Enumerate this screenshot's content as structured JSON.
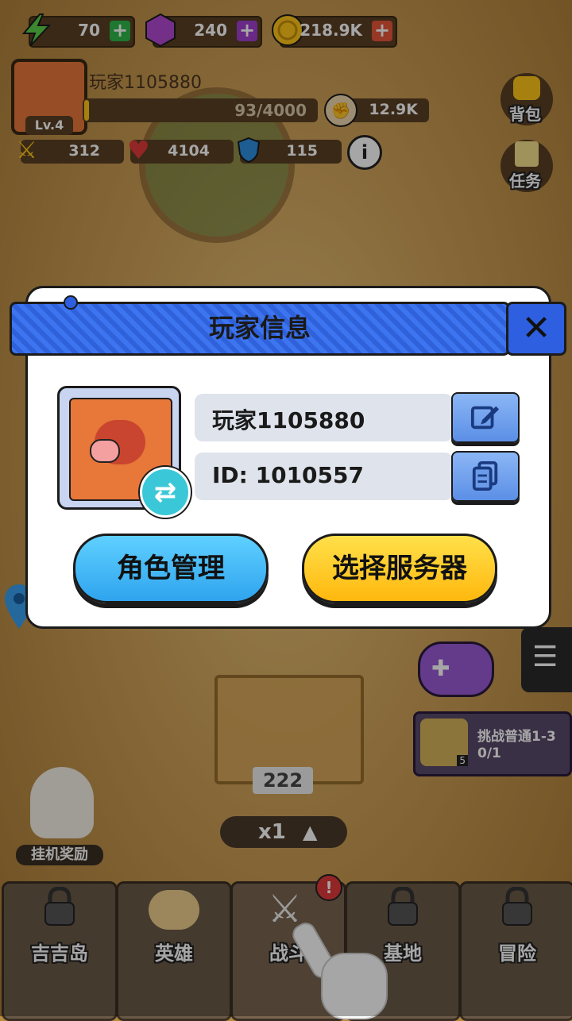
{
  "resources": {
    "energy": "70",
    "gems": "240",
    "coins": "218.9K"
  },
  "player": {
    "name": "玩家1105880",
    "level": "Lv.4",
    "exp": "93/4000",
    "power": "12.9K"
  },
  "stats": {
    "attack": "312",
    "hp": "4104",
    "defense": "115"
  },
  "side_buttons": {
    "bag": "背包",
    "task": "任务"
  },
  "dialog": {
    "title": "玩家信息",
    "name_value": "玩家1105880",
    "id_value": "ID: 1010557",
    "role_button": "角色管理",
    "server_button": "选择服务器"
  },
  "challenge": {
    "title": "挑战普通1-3",
    "progress": "0/1",
    "badge": "5"
  },
  "box_count": "222",
  "speed": "x1",
  "idle_reward": "挂机奖励",
  "bottom_tabs": [
    "吉吉岛",
    "英雄",
    "战斗",
    "基地",
    "冒险"
  ],
  "colors": {
    "accent_blue": "#2d5fe0",
    "cyan_button": "#2fb6f0",
    "yellow_button": "#ffc61a"
  }
}
